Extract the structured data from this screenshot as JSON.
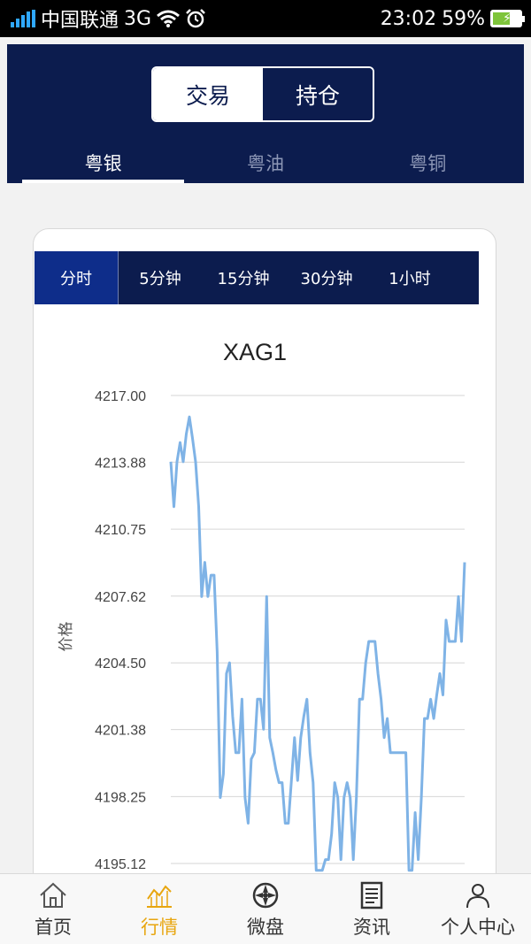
{
  "status": {
    "carrier": "中国联通",
    "network": "3G",
    "time": "23:02",
    "battery": "59%",
    "battery_level": 0.59
  },
  "header": {
    "segment": [
      {
        "label": "交易",
        "active": true
      },
      {
        "label": "持仓",
        "active": false
      }
    ],
    "tabs": [
      {
        "label": "粤银",
        "active": true
      },
      {
        "label": "粤油",
        "active": false
      },
      {
        "label": "粤铜",
        "active": false
      }
    ]
  },
  "periods": [
    "分时",
    "5分钟",
    "15分钟",
    "30分钟",
    "1小时"
  ],
  "nav": [
    {
      "label": "首页",
      "icon": "home-icon",
      "active": false
    },
    {
      "label": "行情",
      "icon": "market-chart-icon",
      "active": true
    },
    {
      "label": "微盘",
      "icon": "wheel-icon",
      "active": false
    },
    {
      "label": "资讯",
      "icon": "news-icon",
      "active": false
    },
    {
      "label": "个人中心",
      "icon": "person-icon",
      "active": false
    }
  ],
  "chart_data": {
    "type": "line",
    "title": "XAG1",
    "ylabel": "价格",
    "xlabel": "",
    "yticks": [
      "4217.00",
      "4213.88",
      "4210.75",
      "4207.62",
      "4204.50",
      "4201.38",
      "4198.25",
      "4195.12"
    ],
    "ylim": [
      4195.12,
      4217.0
    ],
    "grid": true,
    "line_color": "#7fb3e6",
    "series": [
      {
        "values": [
          4213.9,
          4211.8,
          4213.9,
          4214.8,
          4213.9,
          4215.2,
          4216.0,
          4215.0,
          4213.9,
          4211.8,
          4207.6,
          4209.2,
          4207.6,
          4208.6,
          4208.6,
          4205.0,
          4198.2,
          4199.3,
          4204.0,
          4204.5,
          4202.0,
          4200.3,
          4200.3,
          4202.8,
          4198.2,
          4197.0,
          4200.0,
          4200.3,
          4202.8,
          4202.8,
          4201.4,
          4207.6,
          4201.0,
          4200.3,
          4199.5,
          4198.9,
          4198.9,
          4197.0,
          4197.0,
          4199.0,
          4201.0,
          4199.0,
          4201.0,
          4202.0,
          4202.8,
          4200.3,
          4198.9,
          4194.8,
          4194.8,
          4194.8,
          4195.3,
          4195.3,
          4196.5,
          4198.9,
          4198.2,
          4195.3,
          4198.2,
          4198.9,
          4198.2,
          4195.3,
          4198.2,
          4202.8,
          4202.8,
          4204.5,
          4205.5,
          4205.5,
          4205.5,
          4204.0,
          4202.8,
          4201.0,
          4201.9,
          4200.3,
          4200.3,
          4200.3,
          4200.3,
          4200.3,
          4200.3,
          4194.8,
          4194.8,
          4197.5,
          4195.3,
          4198.2,
          4201.9,
          4201.9,
          4202.8,
          4201.9,
          4203.0,
          4204.0,
          4203.0,
          4206.5,
          4205.5,
          4205.5,
          4205.5,
          4207.6,
          4205.5,
          4209.2
        ]
      }
    ]
  }
}
